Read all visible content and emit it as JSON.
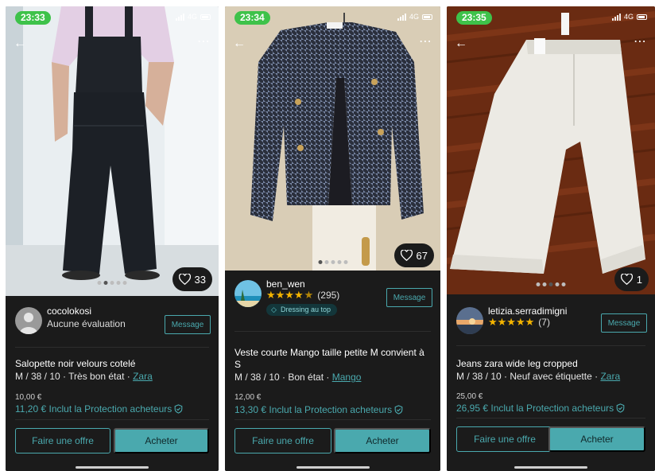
{
  "screens": [
    {
      "status_time": "23:33",
      "network": "4G",
      "likes": "33",
      "seller": {
        "name": "cocolokosi",
        "sub": "Aucune évaluation",
        "rating_count": "",
        "badge": ""
      },
      "message_label": "Message",
      "title": "Salopette noir velours cotelé",
      "meta_prefix": "M / 38 / 10 · Très bon état · ",
      "brand": "Zara",
      "price": "10,00 €",
      "protection": "11,20 € Inclut la Protection acheteurs",
      "offer_label": "Faire une offre",
      "buy_label": "Acheter"
    },
    {
      "status_time": "23:34",
      "network": "4G",
      "likes": "67",
      "seller": {
        "name": "ben_wen",
        "sub": "",
        "rating_count": "(295)",
        "badge": "Dressing au top"
      },
      "message_label": "Message",
      "title": "Veste  courte Mango taille petite M convient à S",
      "meta_prefix": "M / 38 / 10 · Bon état · ",
      "brand": "Mango",
      "price": "12,00 €",
      "protection": "13,30 € Inclut la Protection acheteurs",
      "offer_label": "Faire une offre",
      "buy_label": "Acheter"
    },
    {
      "status_time": "23:35",
      "network": "4G",
      "likes": "1",
      "seller": {
        "name": "letizia.serradimigni",
        "sub": "",
        "rating_count": "(7)",
        "badge": ""
      },
      "message_label": "Message",
      "title": "Jeans zara wide leg cropped",
      "meta_prefix": "M / 38 / 10 · Neuf avec étiquette · ",
      "brand": "Zara",
      "price": "25,00 €",
      "protection": "26,95 € Inclut la Protection acheteurs",
      "offer_label": "Faire une offre",
      "buy_label": "Acheter"
    }
  ],
  "colors": {
    "accent": "#4aa9ae",
    "status_pill": "#3ec24a",
    "panel": "#1b1b1b"
  }
}
